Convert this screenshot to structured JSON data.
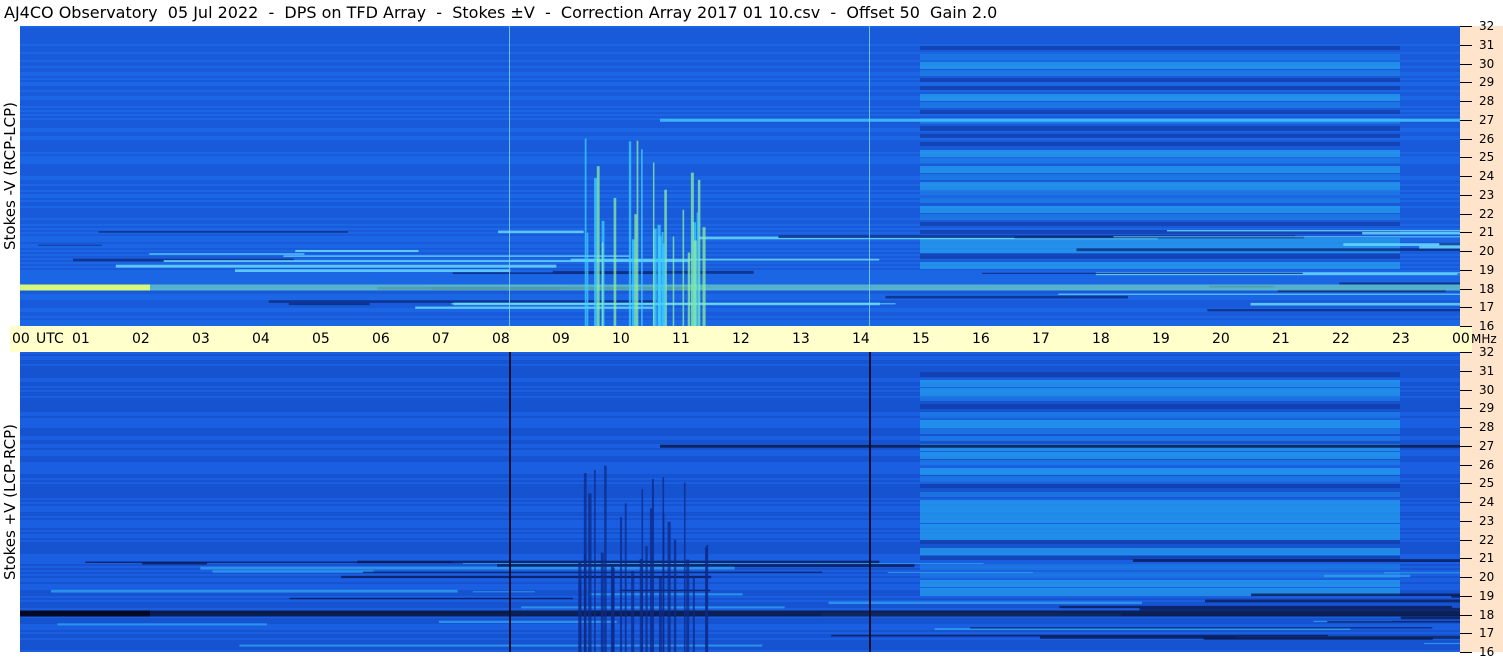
{
  "title": "AJ4CO Observatory  05 Jul 2022  -  DPS on TFD Array  -  Stokes ±V  -  Correction Array 2017 01 10.csv  -  Offset 50  Gain 2.0",
  "colors": {
    "background": "#ffffff",
    "time_axis_band": "#ffffcc",
    "freq_axis_band": "#ffe4cc",
    "spectrogram_base": "#1a5fe0",
    "spectrogram_low": "#0b1a4a",
    "spectrogram_high": "#ffff66"
  },
  "chart_data": {
    "type": "heatmap",
    "title": "AJ4CO Observatory  05 Jul 2022  -  DPS on TFD Array  -  Stokes ±V  -  Correction Array 2017 01 10.csv  -  Offset 50  Gain 2.0",
    "x_axis": {
      "unit_label": "UTC",
      "ticks": [
        "00",
        "01",
        "02",
        "03",
        "04",
        "05",
        "06",
        "07",
        "08",
        "09",
        "10",
        "11",
        "12",
        "13",
        "14",
        "15",
        "16",
        "17",
        "18",
        "19",
        "20",
        "21",
        "22",
        "23",
        "00"
      ],
      "range_hours": [
        0,
        24
      ]
    },
    "y_axis": {
      "unit_label": "MHz",
      "ticks": [
        32,
        31,
        30,
        29,
        28,
        27,
        26,
        25,
        24,
        23,
        22,
        21,
        20,
        19,
        18,
        17,
        16
      ],
      "range_mhz": [
        16,
        32
      ]
    },
    "panels": [
      {
        "ylabel": "Stokes -V (RCP-LCP)",
        "channel": "-V"
      },
      {
        "ylabel": "Stokes +V (LCP-RCP)",
        "channel": "+V"
      }
    ],
    "features": {
      "vertical_lines_utc": [
        8.15,
        14.15
      ],
      "burst_window_utc": [
        9.3,
        11.8
      ]
    },
    "grid": false,
    "legend": "none"
  }
}
